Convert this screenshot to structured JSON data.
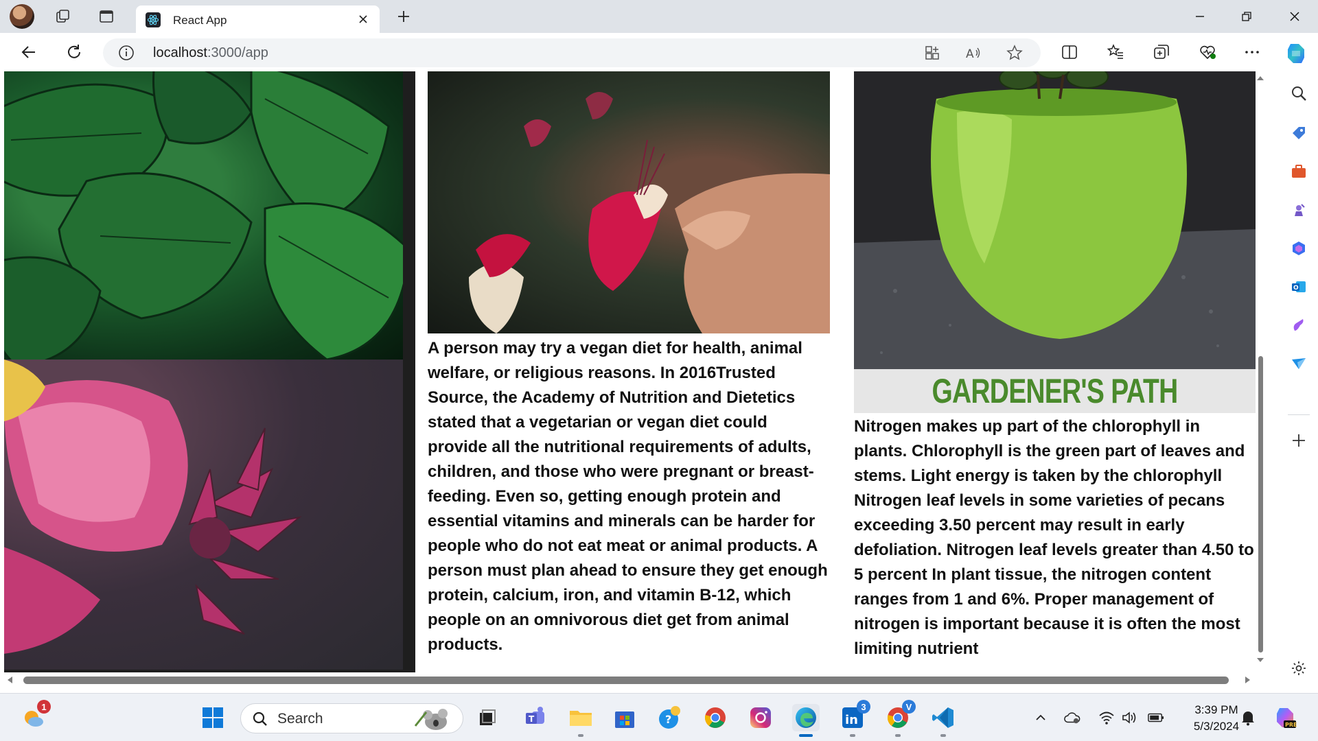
{
  "browser": {
    "tab": {
      "title": "React App"
    },
    "address": {
      "host": "localhost",
      "path": ":3000/app"
    }
  },
  "page": {
    "column_middle": {
      "paragraph": "A person may try a vegan diet for health, animal welfare, or religious reasons. In 2016Trusted Source, the Academy of Nutrition and Dietetics stated that a vegetarian or vegan diet could provide all the nutritional requirements of adults, children, and those who were pregnant or breast-feeding. Even so, getting enough protein and essential vitamins and minerals can be harder for people who do not eat meat or animal products. A person must plan ahead to ensure they get enough protein, calcium, iron, and vitamin B-12, which people on an omnivorous diet get from animal products."
    },
    "column_right": {
      "banner_title": "GARDENER'S PATH",
      "paragraph": "Nitrogen makes up part of the chlorophyll in plants. Chlorophyll is the green part of leaves and stems. Light energy is taken by the chlorophyll Nitrogen leaf levels in some varieties of pecans exceeding 3.50 percent may result in early defoliation. Nitrogen leaf levels greater than 4.50 to 5 percent In plant tissue, the nitrogen content ranges from 1 and 6%. Proper management of nitrogen is important because it is often the most limiting nutrient"
    }
  },
  "taskbar": {
    "search_label": "Search",
    "widgets_badge": "1",
    "linkedin_badge": "3",
    "chrome_badge": "V",
    "time": "3:39 PM",
    "date": "5/3/2024"
  },
  "colors": {
    "accent": "#0067c0",
    "banner_green": "#4a8a2c",
    "pot_green": "#8cc63f"
  }
}
